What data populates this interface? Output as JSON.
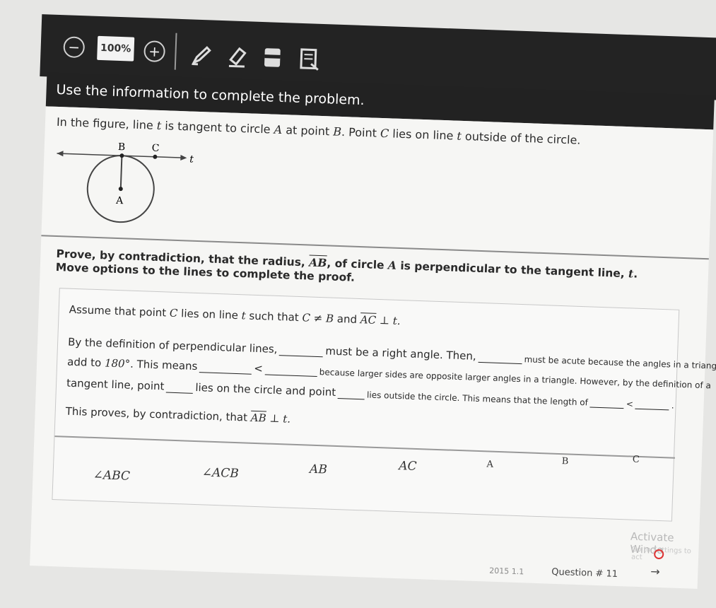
{
  "toolbar": {
    "zoom_level": "100%",
    "icons": [
      "zoom-out-icon",
      "zoom-in-icon",
      "pencil-icon",
      "highlighter-icon",
      "line-reader-icon",
      "notepad-icon"
    ]
  },
  "header": {
    "title": "Use the information to complete the problem."
  },
  "stem": {
    "prefix": "In the figure, line",
    "line_var": "t",
    "middle": "is tangent to circle",
    "circle_var": "A",
    "at_point": "at point",
    "point_b": "B",
    "point_c_text": ". Point",
    "point_c": "C",
    "lies_on": "lies on line",
    "outside": "outside of the circle."
  },
  "figure": {
    "label_b": "B",
    "label_c": "C",
    "label_t": "t",
    "label_a": "A"
  },
  "prompt": {
    "part1": "Prove, by contradiction, that the radius,",
    "segment": "AB",
    "part2": ", of circle",
    "circle_var": "A",
    "part3": "is perpendicular to the tangent line,",
    "line_var": "t",
    "part4": ". Move options to the lines to complete the proof."
  },
  "proof": {
    "l1_a": "Assume that point",
    "l1_c": "C",
    "l1_b": "lies on line",
    "l1_t": "t",
    "l1_d": "such that",
    "l1_expr": "C ≠ B",
    "l1_and": "and",
    "l1_seg": "AC",
    "l1_perp": "⊥ t.",
    "l2_a": "By the definition of perpendicular lines,",
    "l2_b": "must be a right angle. Then,",
    "l2_c": "must be acute because the angles in a triangle",
    "l3_a": "add to",
    "l3_deg": "180°",
    "l3_b": ". This means",
    "lt1": "<",
    "l3_c": "because larger sides are opposite larger angles in a triangle. However, by the definition of a",
    "l4_a": "tangent line, point",
    "l4_b": "lies on the circle and point",
    "l4_c": "lies outside the circle. This means that the length of",
    "lt2": "<",
    "l4_end": ".",
    "l5_a": "This proves, by contradiction, that",
    "l5_seg": "AB",
    "l5_perp": "⊥ t."
  },
  "options": [
    "∠ABC",
    "∠ACB",
    "AB",
    "AC",
    "A",
    "B",
    "C"
  ],
  "system": {
    "watermark1": "Activate Windo",
    "watermark2": "Go to Settings to act"
  },
  "footer": {
    "left_code": "2015 1.1",
    "question": "Question # 11",
    "next_arrow": "→"
  },
  "colors": {
    "toolbar": "#232323",
    "header": "#222222",
    "content": "#f6f6f4"
  }
}
